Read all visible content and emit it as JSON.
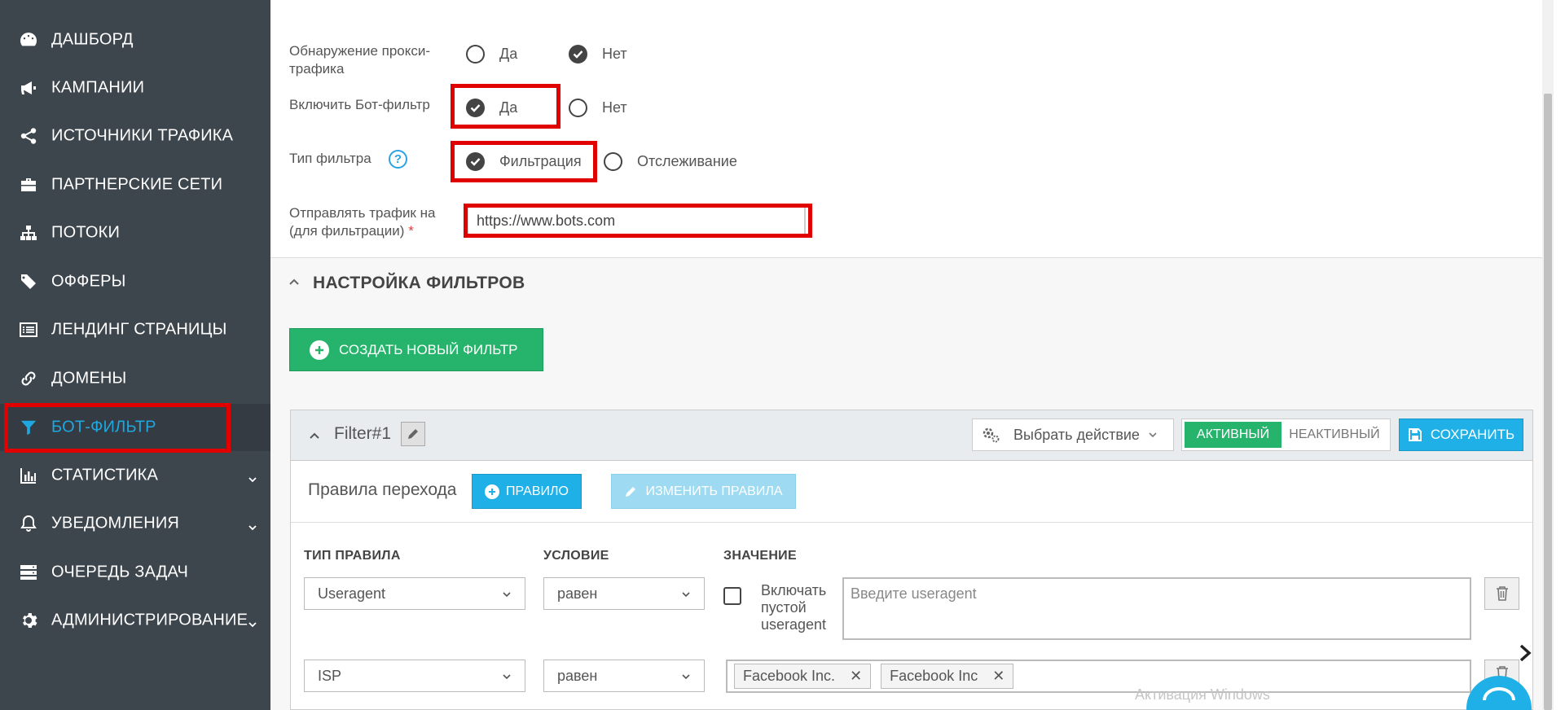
{
  "sidebar": {
    "items": [
      {
        "label": "ДАШБОРД",
        "icon": "dashboard-icon"
      },
      {
        "label": "КАМПАНИИ",
        "icon": "megaphone-icon"
      },
      {
        "label": "ИСТОЧНИКИ ТРАФИКА",
        "icon": "share-icon"
      },
      {
        "label": "ПАРТНЕРСКИЕ СЕТИ",
        "icon": "briefcase-icon"
      },
      {
        "label": "ПОТОКИ",
        "icon": "sitemap-icon"
      },
      {
        "label": "ОФФЕРЫ",
        "icon": "tags-icon"
      },
      {
        "label": "ЛЕНДИНГ СТРАНИЦЫ",
        "icon": "list-icon"
      },
      {
        "label": "ДОМЕНЫ",
        "icon": "link-icon"
      },
      {
        "label": "БОТ-ФИЛЬТР",
        "icon": "filter-icon"
      },
      {
        "label": "СТАТИСТИКА",
        "icon": "bar-chart-icon"
      },
      {
        "label": "УВЕДОМЛЕНИЯ",
        "icon": "bell-icon"
      },
      {
        "label": "ОЧЕРЕДЬ ЗАДАЧ",
        "icon": "server-icon"
      },
      {
        "label": "АДМИНИСТРИРОВАНИЕ",
        "icon": "gear-icon"
      }
    ],
    "active": "БОТ-ФИЛЬТР"
  },
  "settings": {
    "proxy_label": "Обнаружение прокси-трафика",
    "proxy_yes": "Да",
    "proxy_no": "Нет",
    "botfilter_label": "Включить Бот-фильтр",
    "botfilter_yes": "Да",
    "botfilter_no": "Нет",
    "filter_type_label": "Тип фильтра",
    "filter_type_filtering": "Фильтрация",
    "filter_type_tracking": "Отслеживание",
    "send_traffic_label_1": "Отправлять трафик на",
    "send_traffic_label_2": "(для фильтрации)",
    "required_mark": "*",
    "send_traffic_url": "https://www.bots.com"
  },
  "filters_section": {
    "title": "НАСТРОЙКА ФИЛЬТРОВ",
    "create_button": "СОЗДАТЬ НОВЫЙ ФИЛЬТР"
  },
  "filter_card": {
    "name": "Filter#1",
    "action_select": "Выбрать действие",
    "status_active": "АКТИВНЫЙ",
    "status_inactive": "НЕАКТИВНЫЙ",
    "save_button": "СОХРАНИТЬ",
    "rules_title": "Правила перехода",
    "add_rule_button": "ПРАВИЛО",
    "edit_rules_button": "ИЗМЕНИТЬ ПРАВИЛА",
    "columns": {
      "rule_type": "ТИП ПРАВИЛА",
      "condition": "УСЛОВИЕ",
      "value": "ЗНАЧЕНИЕ"
    },
    "rules": [
      {
        "type": "Useragent",
        "condition": "равен",
        "include_empty_label_1": "Включать",
        "include_empty_label_2": "пустой",
        "include_empty_label_3": "useragent",
        "value_placeholder": "Введите useragent"
      },
      {
        "type": "ISP",
        "condition": "равен",
        "tags": [
          "Facebook Inc.",
          "Facebook Inc"
        ]
      }
    ]
  },
  "overlay": {
    "windows_activation": "Активация Windows"
  },
  "colors": {
    "sidebar_bg": "#3d454d",
    "active_nav": "#1ea7e1",
    "green": "#26b46c",
    "blue": "#1eb0e6",
    "highlight_red": "#e00000"
  }
}
